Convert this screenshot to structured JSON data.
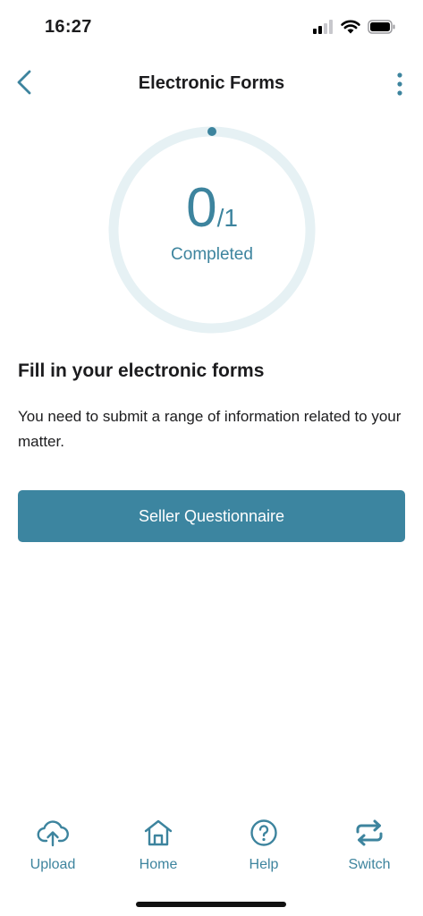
{
  "status_bar": {
    "time": "16:27"
  },
  "nav": {
    "title": "Electronic Forms"
  },
  "progress": {
    "completed": "0",
    "total_text": "/1",
    "completed_value": 0,
    "total_value": 1,
    "label": "Completed"
  },
  "content": {
    "heading": "Fill in your electronic forms",
    "description": "You need to submit a range of information related to your matter."
  },
  "actions": {
    "primary_label": "Seller Questionnaire"
  },
  "tabs": [
    {
      "label": "Upload",
      "icon": "cloud-upload-icon"
    },
    {
      "label": "Home",
      "icon": "home-icon"
    },
    {
      "label": "Help",
      "icon": "help-icon"
    },
    {
      "label": "Switch",
      "icon": "switch-icon"
    }
  ],
  "colors": {
    "accent": "#3d849e",
    "button": "#3c85a0",
    "ring_track": "#e6f1f4"
  }
}
